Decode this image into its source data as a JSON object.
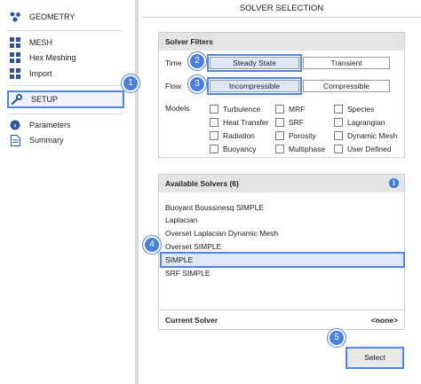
{
  "sidebar": {
    "items": [
      {
        "label": "GEOMETRY",
        "icon": "geometry-icon"
      },
      {
        "label": "MESH",
        "icon": "mesh-icon"
      },
      {
        "label": "Hex Meshing",
        "icon": "hex-meshing-icon"
      },
      {
        "label": "Import",
        "icon": "import-icon"
      },
      {
        "label": "SETUP",
        "icon": "wrench-icon",
        "active": true
      },
      {
        "label": "Parameters",
        "icon": "parameters-icon"
      },
      {
        "label": "Summary",
        "icon": "document-icon"
      }
    ]
  },
  "main": {
    "title": "SOLVER SELECTION",
    "filters": {
      "header": "Solver Filters",
      "time": {
        "label": "Time",
        "options": [
          "Steady State",
          "Transient"
        ],
        "selected": "Steady State"
      },
      "flow": {
        "label": "Flow",
        "options": [
          "Incompressible",
          "Compressible"
        ],
        "selected": "Incompressible"
      },
      "models": {
        "label": "Models",
        "options": [
          "Turbulence",
          "MRF",
          "Species",
          "Heat Transfer",
          "SRF",
          "Lagrangian",
          "Radiation",
          "Porosity",
          "Dynamic Mesh",
          "Buoyancy",
          "Multiphase",
          "User Defined"
        ]
      }
    },
    "solvers": {
      "header": "Available Solvers (6)",
      "info_glyph": "i",
      "items": [
        "Buoyant Boussinesq SIMPLE",
        "Laplacian",
        "Overset Laplacian Dynamic Mesh",
        "Overset SIMPLE",
        "SIMPLE",
        "SRF SIMPLE"
      ],
      "selected": "SIMPLE",
      "current_label": "Current Solver",
      "current_value": "<none>"
    },
    "select_label": "Select"
  },
  "callouts": [
    "1",
    "2",
    "3",
    "4",
    "5"
  ],
  "colors": {
    "accent": "#4f86e8",
    "badge": "#4c7fd9",
    "selected_bg": "#dfe8f7",
    "header_bg": "#e4e4e4"
  }
}
